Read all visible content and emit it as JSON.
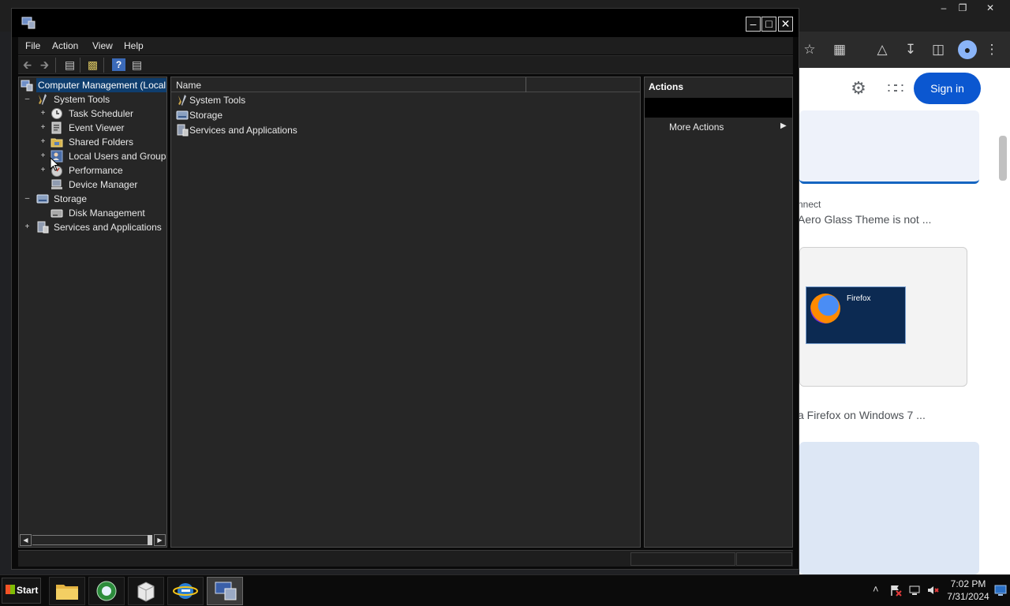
{
  "browser": {
    "sign_in_label": "Sign in",
    "result_1_source": "nnect",
    "result_1_title": "Aero Glass Theme is not ...",
    "result_2_title": "a Firefox on Windows 7 ...",
    "thumb_2_caption": "Firefox"
  },
  "window": {
    "menu": [
      "File",
      "Action",
      "View",
      "Help"
    ]
  },
  "tree": {
    "root": "Computer Management (Local",
    "system_tools": "System Tools",
    "task_scheduler": "Task Scheduler",
    "event_viewer": "Event Viewer",
    "shared_folders": "Shared Folders",
    "local_users": "Local Users and Groups",
    "performance": "Performance",
    "device_manager": "Device Manager",
    "storage": "Storage",
    "disk_management": "Disk Management",
    "services": "Services and Applications"
  },
  "list": {
    "column_name": "Name",
    "rows": [
      "System Tools",
      "Storage",
      "Services and Applications"
    ]
  },
  "actions": {
    "header": "Actions",
    "more_actions": "More Actions"
  },
  "taskbar": {
    "start_label": "Start",
    "time": "7:02 PM",
    "date": "7/31/2024"
  },
  "colors": {
    "selection": "#0f3e6e",
    "accent_blue": "#0b57d0"
  }
}
